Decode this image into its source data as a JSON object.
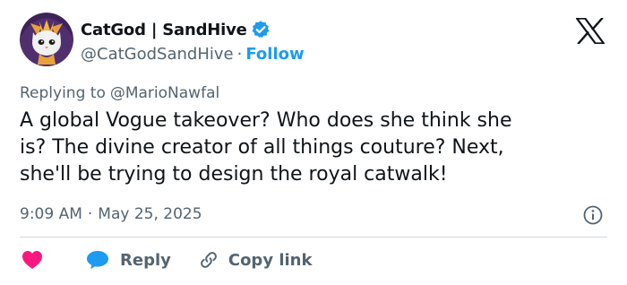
{
  "author": {
    "display_name": "CatGod | SandHive",
    "handle": "@CatGodSandHive",
    "separator": "·",
    "follow_label": "Follow",
    "avatar_icon": "cat-god-avatar",
    "verified_icon": "verified-badge-icon"
  },
  "platform_logo": "x-logo",
  "reply_context": {
    "prefix": "Replying to",
    "mention": "@MarioNawfal"
  },
  "tweet": {
    "text": "A global Vogue takeover? Who does she think she\nis? The divine creator of all things couture? Next,\nshe'll be trying to design the royal catwalk!"
  },
  "meta": {
    "time": "9:09 AM",
    "separator": "·",
    "date": "May 25, 2025",
    "info_icon": "info-icon"
  },
  "actions": {
    "like_icon": "heart-icon",
    "reply_icon": "speech-bubble-icon",
    "reply_label": "Reply",
    "copy_icon": "link-icon",
    "copy_label": "Copy link"
  },
  "colors": {
    "accent": "#1d9bf0",
    "like": "#f91880",
    "text": "#0f1419",
    "secondary_text": "#536471",
    "divider": "#cfd9de"
  }
}
